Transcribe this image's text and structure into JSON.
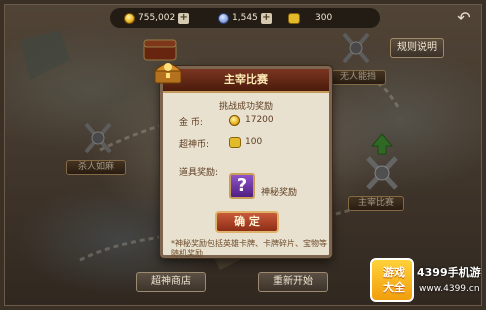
{
  "resources": {
    "gold": "755,002",
    "gems": "1,545",
    "tickets": "300"
  },
  "rules_button": "规则说明",
  "map_nodes": {
    "left": "杀人如麻",
    "right_top": "无人能挡",
    "right_bottom": "主宰比赛"
  },
  "bottom": {
    "shop": "超神商店",
    "restart": "重新开始"
  },
  "dialog": {
    "title": "主宰比赛",
    "subtitle": "挑战成功奖励",
    "gold_label": "金    币:",
    "gold_value": "17200",
    "super_coin_label": "超神币:",
    "super_coin_value": "100",
    "item_label": "道具奖励:",
    "item_icon": "?",
    "item_name": "神秘奖励",
    "confirm": "确  定",
    "note": "*神秘奖励包括英雄卡牌、卡牌碎片、宝物等随机奖励"
  },
  "watermark": {
    "badge_line1": "游戏",
    "badge_line2": "大全",
    "brand": "4399手机游戏",
    "url": "www.4399.cn"
  },
  "colors": {
    "dialog_bg": "#e9e1cf",
    "header_red": "#7a3520",
    "confirm_red": "#c85a3a",
    "mystery_purple": "#8f54c8"
  }
}
